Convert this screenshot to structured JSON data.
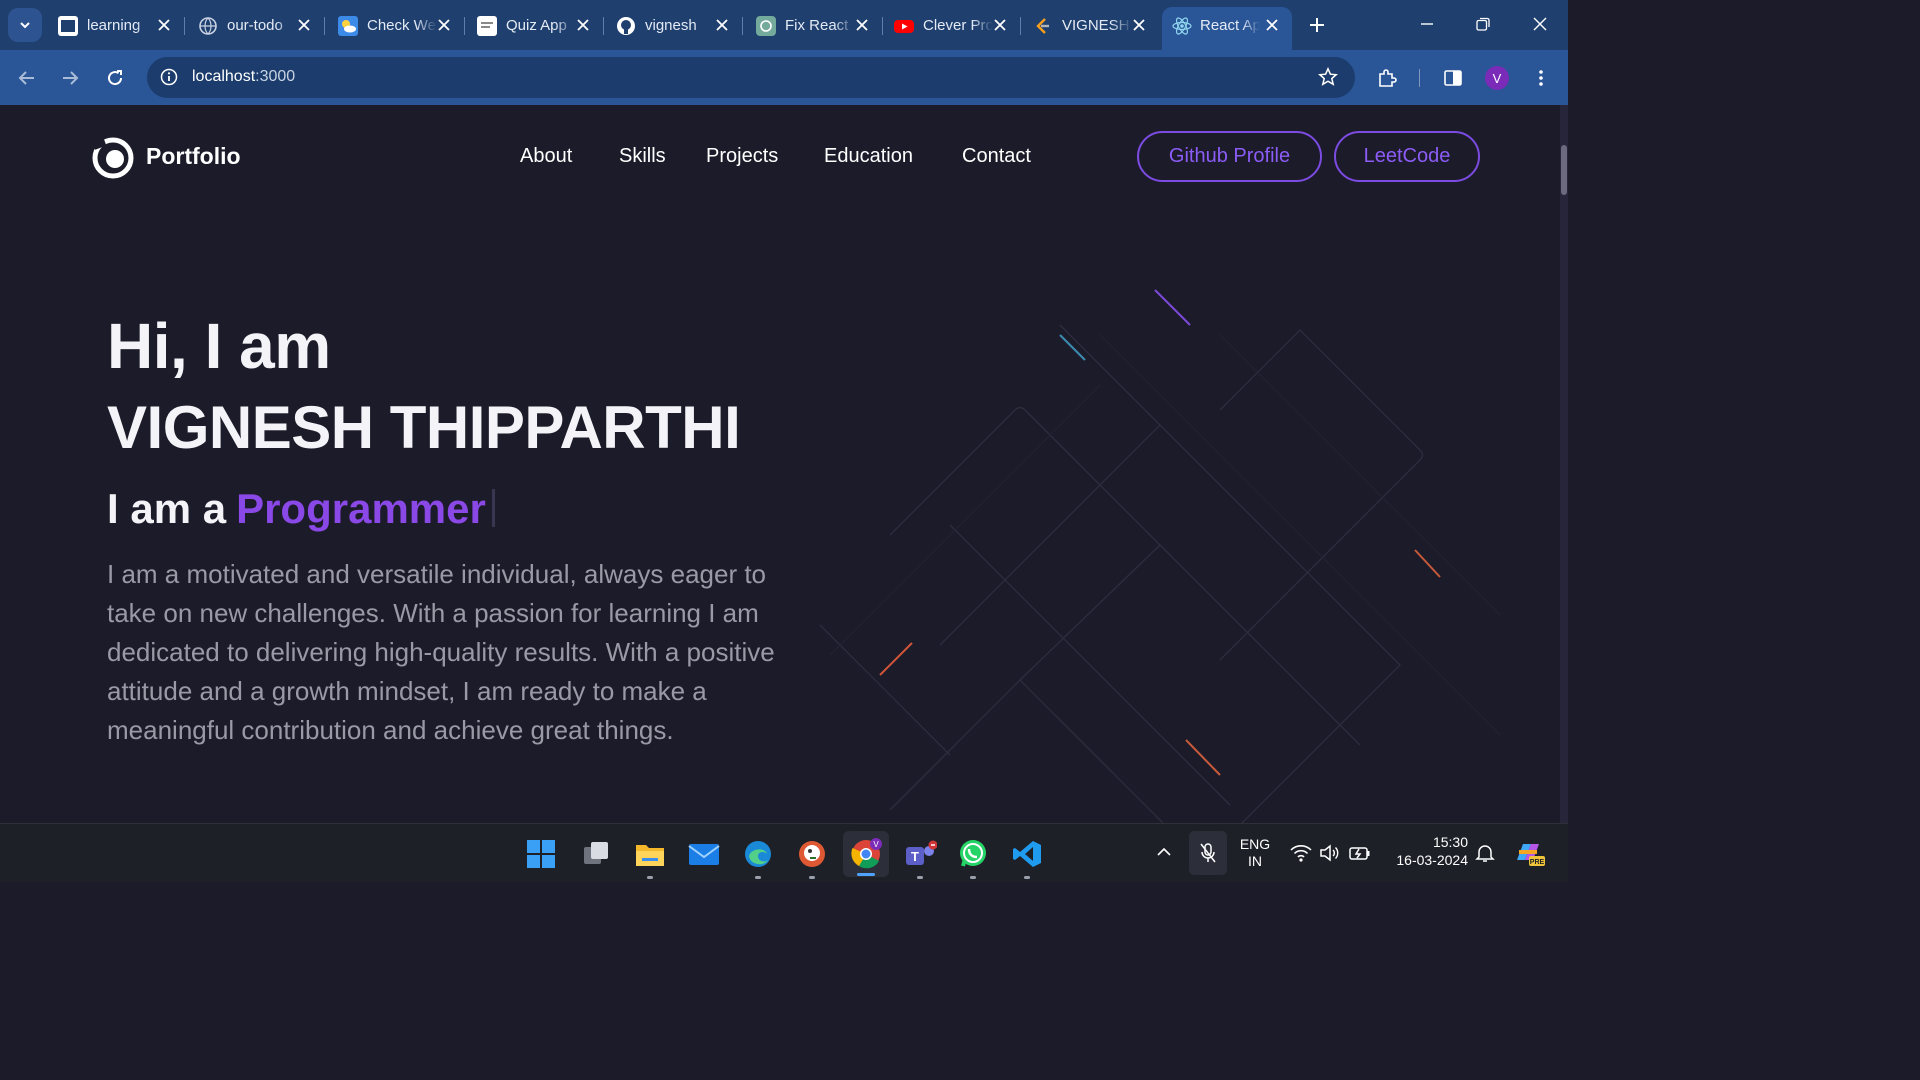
{
  "browser": {
    "tabs": [
      {
        "title": "learning",
        "favicon": "nxtwave-icon"
      },
      {
        "title": "our-todo",
        "favicon": "globe-icon"
      },
      {
        "title": "Check Weather",
        "favicon": "weather-icon"
      },
      {
        "title": "Quiz App",
        "favicon": "document-icon"
      },
      {
        "title": "vignesh",
        "favicon": "github-icon"
      },
      {
        "title": "Fix React",
        "favicon": "chatgpt-icon"
      },
      {
        "title": "Clever Programmer",
        "favicon": "youtube-icon"
      },
      {
        "title": "VIGNESH",
        "favicon": "leetcode-icon"
      },
      {
        "title": "React App",
        "favicon": "react-icon",
        "active": true
      }
    ],
    "url_host": "localhost",
    "url_port": ":3000",
    "profile_initial": "V"
  },
  "site": {
    "brand": "Portfolio",
    "nav": [
      "About",
      "Skills",
      "Projects",
      "Education",
      "Contact"
    ],
    "buttons": {
      "github": "Github Profile",
      "leetcode": "LeetCode"
    },
    "hero": {
      "greeting": "Hi, I am",
      "name": "VIGNESH THIPPARTHI",
      "role_prefix": "I am a",
      "role_word": "Programmer",
      "description": "I am a motivated and versatile individual, always eager to take on new challenges. With a passion for learning I am dedicated to delivering high-quality results. With a positive attitude and a growth mindset, I am ready to make a meaningful contribution and achieve great things."
    },
    "colors": {
      "accent": "#8a48e6",
      "background": "#1c1b29"
    }
  },
  "taskbar": {
    "apps": [
      "windows-start-icon",
      "task-view-icon",
      "file-explorer-icon",
      "mail-icon",
      "edge-icon",
      "duckduckgo-icon",
      "chrome-icon",
      "teams-icon",
      "whatsapp-icon",
      "vscode-icon"
    ],
    "language": "ENG",
    "region": "IN",
    "time": "15:30",
    "date": "16-03-2024"
  }
}
